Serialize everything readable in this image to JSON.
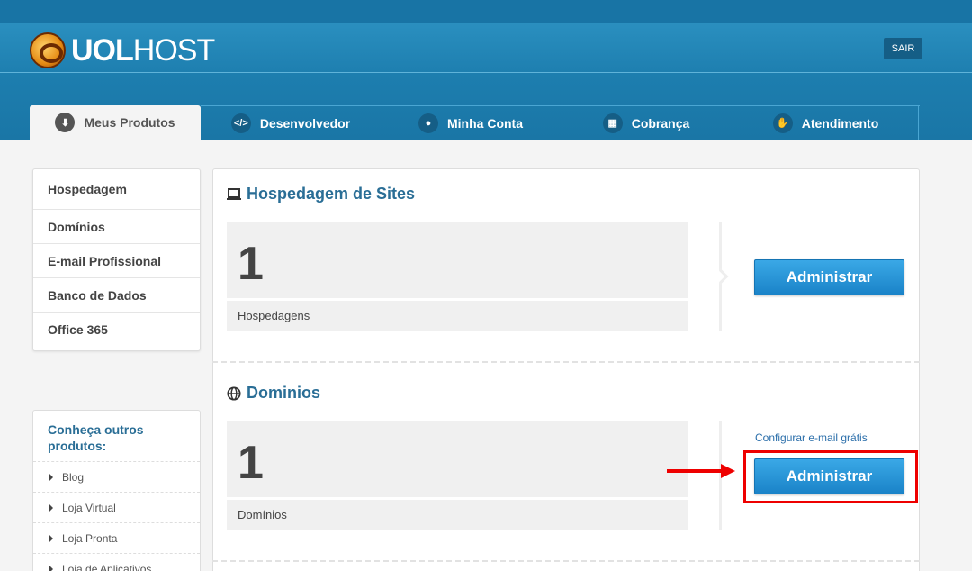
{
  "header": {
    "logo_bold": "UOL",
    "logo_light": "HOST",
    "logout_label": "SAIR"
  },
  "tabs": [
    {
      "label": "Meus Produtos",
      "icon": "download-icon",
      "active": true
    },
    {
      "label": "Desenvolvedor",
      "icon": "code-icon",
      "active": false
    },
    {
      "label": "Minha Conta",
      "icon": "user-icon",
      "active": false
    },
    {
      "label": "Cobrança",
      "icon": "calculator-icon",
      "active": false
    },
    {
      "label": "Atendimento",
      "icon": "handshake-icon",
      "active": false
    }
  ],
  "sidebar": {
    "items": [
      {
        "label": "Hospedagem"
      },
      {
        "label": "Domínios"
      },
      {
        "label": "E-mail Profissional"
      },
      {
        "label": "Banco de Dados"
      },
      {
        "label": "Office 365"
      }
    ],
    "others_title": "Conheça outros produtos:",
    "others": [
      {
        "label": "Blog"
      },
      {
        "label": "Loja Virtual"
      },
      {
        "label": "Loja Pronta"
      },
      {
        "label": "Loja de Aplicativos"
      }
    ]
  },
  "sections": [
    {
      "title": "Hospedagem de Sites",
      "icon": "monitor-icon",
      "count": "1",
      "count_label": "Hospedagens",
      "button_label": "Administrar"
    },
    {
      "title": "Dominios",
      "icon": "globe-icon",
      "count": "1",
      "count_label": "Domínios",
      "button_label": "Administrar",
      "link_label": "Configurar e-mail grátis"
    }
  ],
  "colors": {
    "header_blue": "#1e7fb0",
    "button_blue": "#1a83c8",
    "title_blue": "#2a6e96",
    "highlight_red": "#ee0000"
  }
}
